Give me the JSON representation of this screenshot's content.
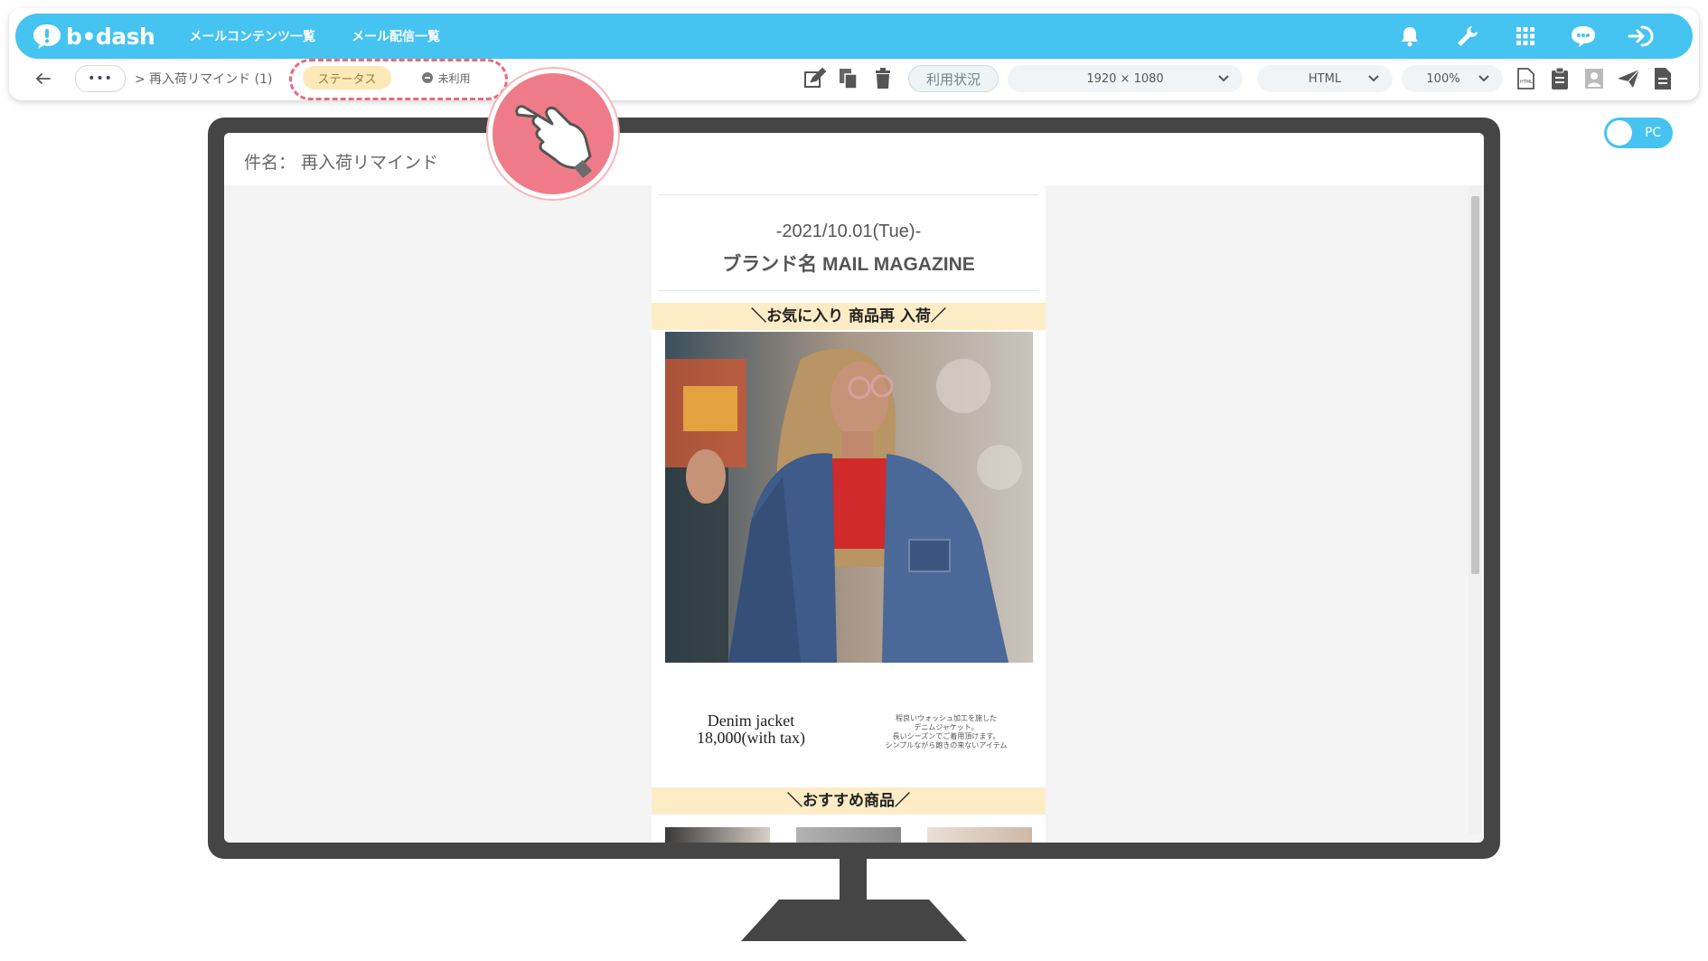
{
  "app": {
    "logo_text": "b•dash",
    "nav": [
      {
        "label": "メールコンテンツ一覧"
      },
      {
        "label": "メール配信一覧"
      }
    ],
    "top_icons": [
      "bell-icon",
      "wrench-icon",
      "grid-icon",
      "chat-icon",
      "logout-icon"
    ],
    "brand_color": "#45c3f1"
  },
  "toolbar": {
    "more_label": "•••",
    "breadcrumb": "> 再入荷リマインド (1)",
    "status_label": "ステータス",
    "status_value": "未利用",
    "usage_label": "利用状況",
    "resolution": "1920 × 1080",
    "format": "HTML",
    "zoom": "100%",
    "right_icons": [
      "html-file-icon",
      "clipboard-icon",
      "person-card-icon",
      "send-icon",
      "document-icon"
    ]
  },
  "toggle": {
    "label": "PC"
  },
  "preview": {
    "subject": "件名： 再入荷リマインド",
    "date": "-2021/10.01(Tue)-",
    "brand": "ブランド名 MAIL MAGAZINE",
    "section1": "＼お気に入り 商品再 入荷／",
    "product_name": "Denim jacket",
    "product_price": "18,000(with tax)",
    "product_desc": [
      "程良いウォッシュ加工を施した",
      "デニムジャケット。",
      "長いシーズンでご着用頂けます。",
      "シンプルながら飽きの来ないアイテム"
    ],
    "section2": "＼おすすめ商品／"
  }
}
